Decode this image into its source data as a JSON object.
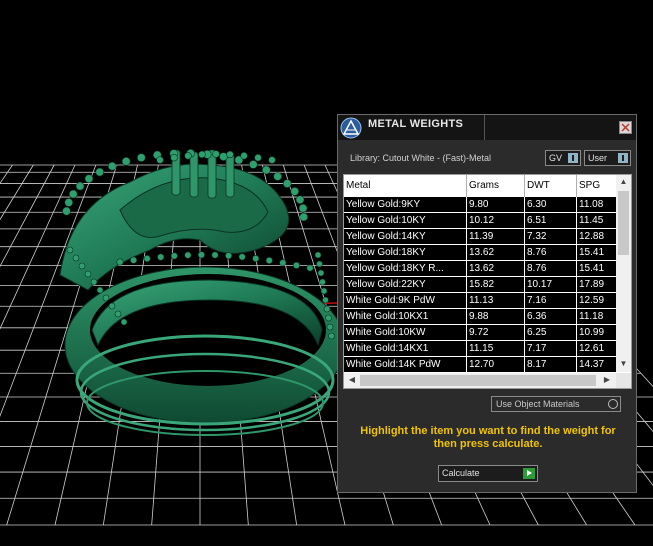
{
  "panel": {
    "title": "METAL WEIGHTS",
    "library_label": "Library: Cutout White - (Fast)-Metal",
    "toggle_gv": "GV",
    "toggle_user": "User",
    "columns": [
      "Metal",
      "Grams",
      "DWT",
      "SPG"
    ],
    "rows": [
      [
        "Yellow Gold:9KY",
        "9.80",
        "6.30",
        "11.08"
      ],
      [
        "Yellow Gold:10KY",
        "10.12",
        "6.51",
        "11.45"
      ],
      [
        "Yellow Gold:14KY",
        "11.39",
        "7.32",
        "12.88"
      ],
      [
        "Yellow Gold:18KY",
        "13.62",
        "8.76",
        "15.41"
      ],
      [
        "Yellow Gold:18KY R...",
        "13.62",
        "8.76",
        "15.41"
      ],
      [
        "Yellow Gold:22KY",
        "15.82",
        "10.17",
        "17.89"
      ],
      [
        "White Gold:9K PdW",
        "11.13",
        "7.16",
        "12.59"
      ],
      [
        "White Gold:10KX1",
        "9.88",
        "6.36",
        "11.18"
      ],
      [
        "White Gold:10KW",
        "9.72",
        "6.25",
        "10.99"
      ],
      [
        "White Gold:14KX1",
        "11.15",
        "7.17",
        "12.61"
      ],
      [
        "White Gold:14K PdW",
        "12.70",
        "8.17",
        "14.37"
      ]
    ],
    "use_materials": "Use Object Materials",
    "instruction": "Highlight the item you want to find the weight for then press calculate.",
    "calculate": "Calculate"
  },
  "colors": {
    "ring": "#1f7a55",
    "instruction": "#f0c400",
    "grid": "#cfcfcf"
  },
  "icons": {
    "logo": "rhino-logo-icon",
    "close": "close-icon",
    "toggle": "toggle-switch-icon",
    "radio": "radio-circle-icon",
    "go": "play-arrow-icon"
  }
}
